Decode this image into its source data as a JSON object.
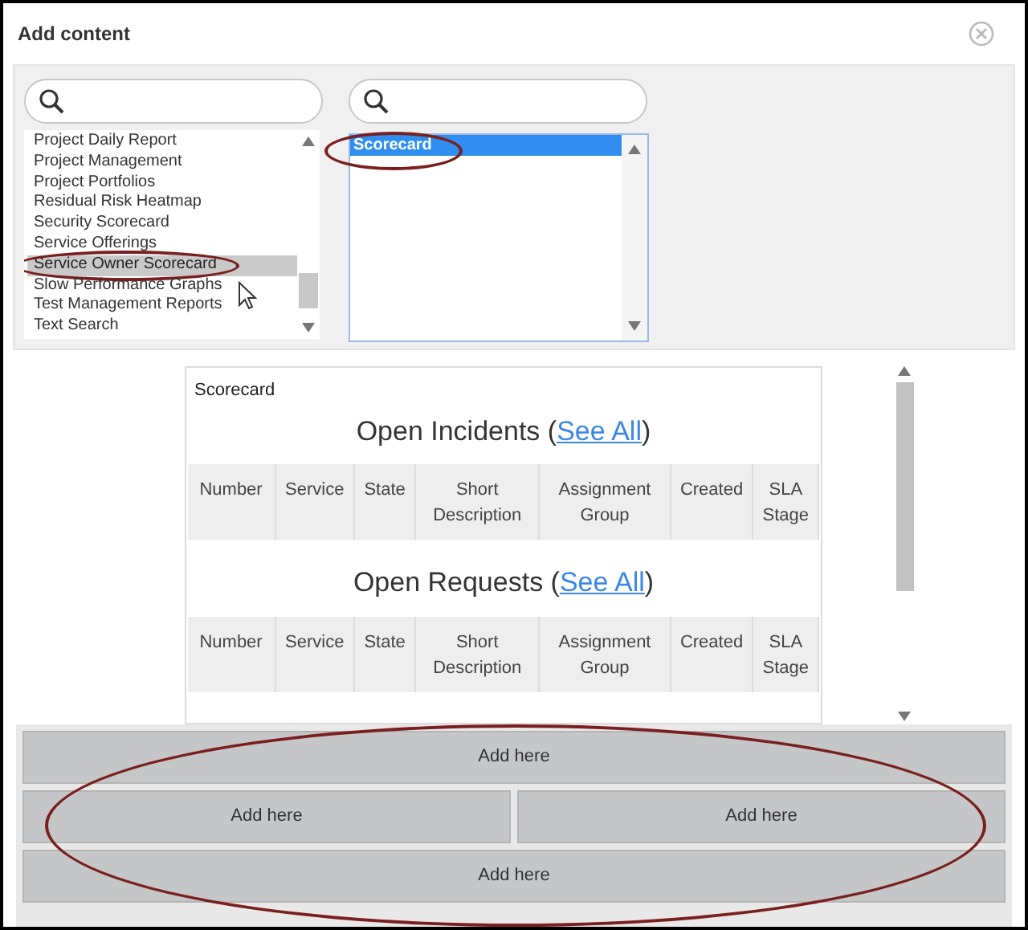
{
  "window": {
    "title": "Add content"
  },
  "left_list": {
    "items": [
      {
        "label": "Project Daily Report",
        "selected": false
      },
      {
        "label": "Project Management",
        "selected": false
      },
      {
        "label": "Project Portfolios",
        "selected": false
      },
      {
        "label": "Residual Risk Heatmap",
        "selected": false
      },
      {
        "label": "Security Scorecard",
        "selected": false
      },
      {
        "label": "Service Offerings",
        "selected": false
      },
      {
        "label": "Service Owner Scorecard",
        "selected": true
      },
      {
        "label": "Slow Performance Graphs",
        "selected": false
      },
      {
        "label": "Test Management Reports",
        "selected": false
      },
      {
        "label": "Text Search",
        "selected": false
      }
    ]
  },
  "right_list": {
    "items": [
      {
        "label": "Scorecard",
        "selected": true
      }
    ]
  },
  "preview": {
    "label": "Scorecard",
    "sections": [
      {
        "title": "Open Incidents (",
        "link": "See All",
        "close": ")",
        "columns": [
          "Number",
          "Service",
          "State",
          "Short Description",
          "Assignment Group",
          "Created",
          "SLA Stage"
        ]
      },
      {
        "title": "Open Requests (",
        "link": "See All",
        "close": ")",
        "columns": [
          "Number",
          "Service",
          "State",
          "Short Description",
          "Assignment Group",
          "Created",
          "SLA Stage"
        ]
      }
    ]
  },
  "drop_rows": [
    [
      "Add here"
    ],
    [
      "Add here",
      "Add here"
    ],
    [
      "Add here"
    ]
  ]
}
